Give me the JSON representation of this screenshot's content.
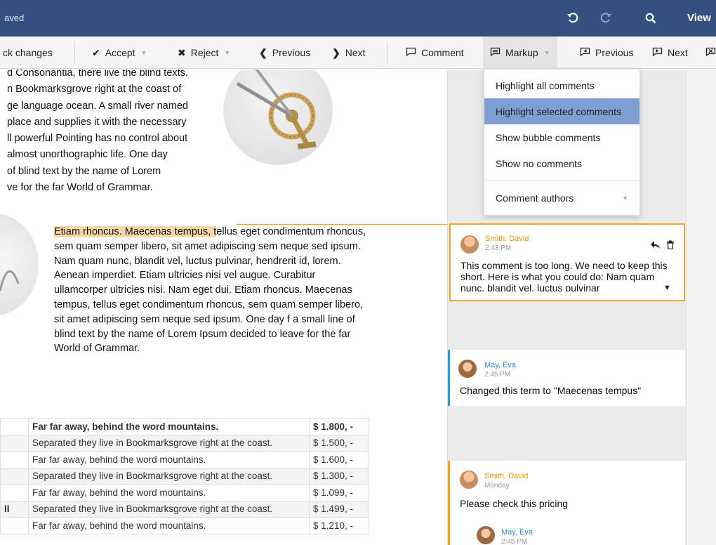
{
  "titlebar": {
    "status": "aved",
    "undo_icon": "undo-icon",
    "redo_icon": "redo-icon",
    "search_icon": "search-icon",
    "view_label": "View"
  },
  "toolbar": {
    "track_changes": "ck changes",
    "accept": "Accept",
    "reject": "Reject",
    "previous": "Previous",
    "next": "Next",
    "comment": "Comment",
    "markup": "Markup",
    "comment_previous": "Previous",
    "comment_next": "Next"
  },
  "document": {
    "para1_lines": [
      "d Consonantia, there live the blind texts.",
      "n Bookmarksgrove right at the coast of",
      "ge language ocean. A small river named",
      " place and supplies it with the necessary",
      "ll powerful Pointing has no control about",
      " almost unorthographic life. One day",
      " of blind text by the name of Lorem",
      "ve for the far World of Grammar."
    ],
    "para2_highlight": "Etiam rhoncus. Maecenas tempus, t",
    "para2_rest": "ellus eget condimentum rhoncus, sem quam semper libero, sit amet adipiscing sem neque sed ipsum. Nam quam nunc, blandit vel, luctus pulvinar, hendrerit id, lorem. Aenean imperdiet. Etiam ultricies nisi vel augue. Curabitur ullamcorper ultricies nisi. Nam eget dui. Etiam rhoncus. Maecenas tempus, tellus eget condimentum rhoncus, sem quam semper libero, sit amet adipiscing sem neque sed ipsum. One day f a small line of blind text by the name of Lorem Ipsum decided to leave for the far World of Grammar.",
    "table": [
      [
        "",
        "Far far away, behind the word mountains.",
        "$ 1.800, -"
      ],
      [
        "",
        "Separated they live in Bookmarksgrove right at the coast.",
        "$ 1.500, -"
      ],
      [
        "",
        "Far far away, behind the word mountains.",
        "$ 1.600, -"
      ],
      [
        "",
        "Separated they live in Bookmarksgrove right at the coast.",
        "$ 1.300, -"
      ],
      [
        "",
        "Far far away, behind the word mountains.",
        "$ 1.099, -"
      ],
      [
        "II",
        "Separated they live in Bookmarksgrove right at the coast.",
        "$ 1.499, -"
      ],
      [
        "",
        "Far far away, behind the word mountains.",
        "$ 1.210, -"
      ]
    ]
  },
  "markup_menu": {
    "items": [
      "Highlight all comments",
      "Highlight selected comments",
      "Show bubble comments",
      "Show no comments"
    ],
    "selected_index": 1,
    "authors_label": "Comment authors"
  },
  "comments": [
    {
      "author": "Smith, David",
      "time": "2:43 PM",
      "text": "This comment is too long. We need to keep this short. Here is what you could do:",
      "overflow": "Nam quam nunc, blandit vel, luctus pulvinar",
      "color": "#f0a320"
    },
    {
      "author": "May, Eva",
      "time": "2:45 PM",
      "text": "Changed this term to \"Maecenas tempus\"",
      "color": "#2f9bd6"
    },
    {
      "author": "Smith, David",
      "time": "Monday",
      "text": "Please check this pricing",
      "color": "#f0a320",
      "reply": {
        "author": "May, Eva",
        "time": "2:45 PM"
      }
    }
  ],
  "colors": {
    "titlebar": "#33507f",
    "accent_orange": "#f0a320",
    "accent_blue": "#2f9bd6",
    "menu_selected": "#7d9fd4"
  }
}
